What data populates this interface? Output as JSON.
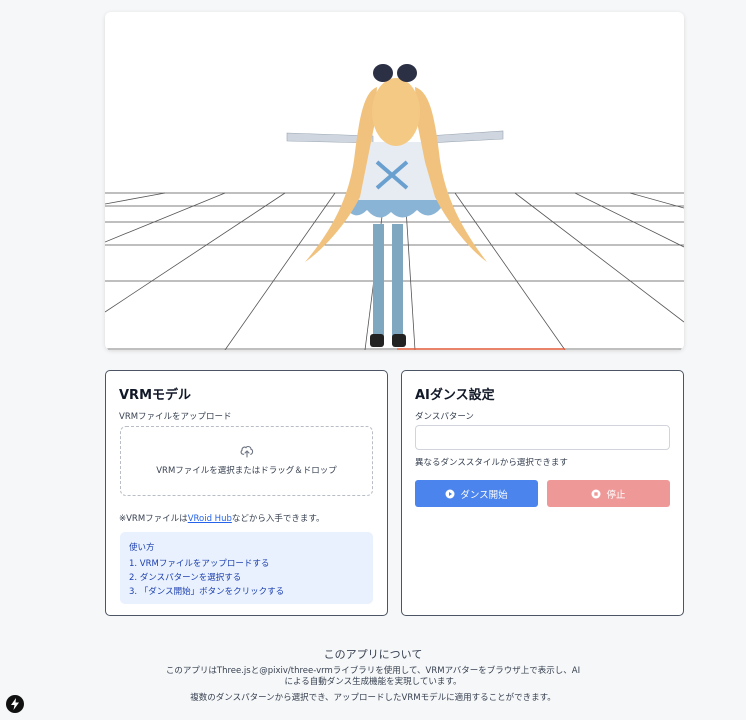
{
  "vrm_card": {
    "title": "VRMモデル",
    "upload_label": "VRMファイルをアップロード",
    "dropzone_text": "VRMファイルを選択またはドラッグ＆ドロップ",
    "note_prefix": "※VRMファイルは",
    "note_link": "VRoid Hub",
    "note_suffix": "などから入手できます。",
    "howto_title": "使い方",
    "howto_steps": [
      "1. VRMファイルをアップロードする",
      "2. ダンスパターンを選択する",
      "3. 「ダンス開始」ボタンをクリックする"
    ]
  },
  "dance_card": {
    "title": "AIダンス設定",
    "pattern_label": "ダンスパターン",
    "select_value": "",
    "helper_text": "異なるダンススタイルから選択できます",
    "start_button": "ダンス開始",
    "stop_button": "停止"
  },
  "about": {
    "title": "このアプリについて",
    "line1": "このアプリはThree.jsと@pixiv/three-vrmライブラリを使用して、VRMアバターをブラウザ上で表示し、AI",
    "line2": "による自動ダンス生成機能を実現しています。",
    "line3": "複数のダンスパターンから選択でき、アップロードしたVRMモデルに適用することができます。"
  },
  "colors": {
    "start_button": "#4b84ec",
    "stop_button": "#ee9898",
    "howto_bg": "#e8f1fd",
    "link": "#2563eb"
  }
}
